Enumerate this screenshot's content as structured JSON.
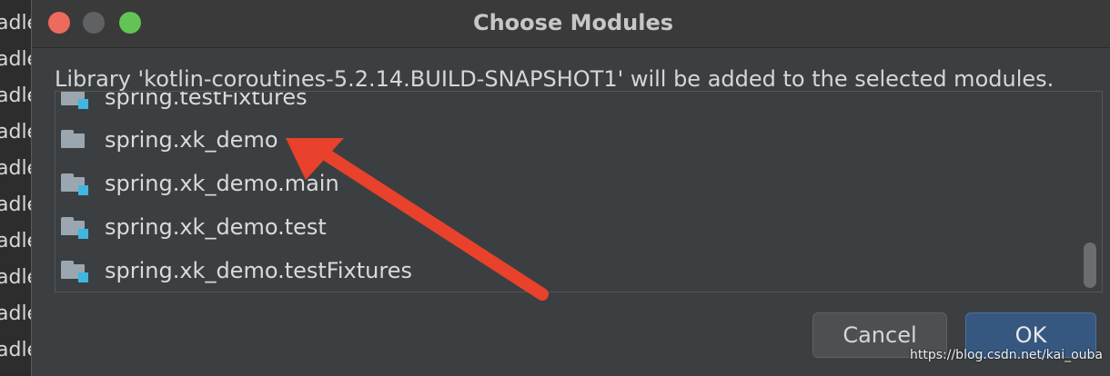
{
  "background_editor": {
    "lines": [
      "adle",
      "adle",
      "adle",
      "adle",
      "adle",
      "adle",
      "adle",
      "adle",
      "adle",
      "adle"
    ]
  },
  "dialog": {
    "title": "Choose Modules",
    "message": "Library 'kotlin-coroutines-5.2.14.BUILD-SNAPSHOT1' will be added to the selected modules.",
    "modules": [
      {
        "label": "spring.testFixtures",
        "icon": "module-folder-icon"
      },
      {
        "label": "spring.xk_demo",
        "icon": "module-folder-icon"
      },
      {
        "label": "spring.xk_demo.main",
        "icon": "module-folder-icon"
      },
      {
        "label": "spring.xk_demo.test",
        "icon": "module-folder-icon"
      },
      {
        "label": "spring.xk_demo.testFixtures",
        "icon": "module-folder-icon"
      }
    ],
    "buttons": {
      "cancel": "Cancel",
      "ok": "OK"
    }
  },
  "annotation": {
    "arrow_color": "#e8412c",
    "points_to": "spring.xk_demo"
  },
  "watermark": "https://blog.csdn.net/kai_ouba",
  "colors": {
    "close": "#ed6a5e",
    "zoom": "#61c454",
    "module_mark": "#40b6e0",
    "ok_button": "#365880"
  }
}
